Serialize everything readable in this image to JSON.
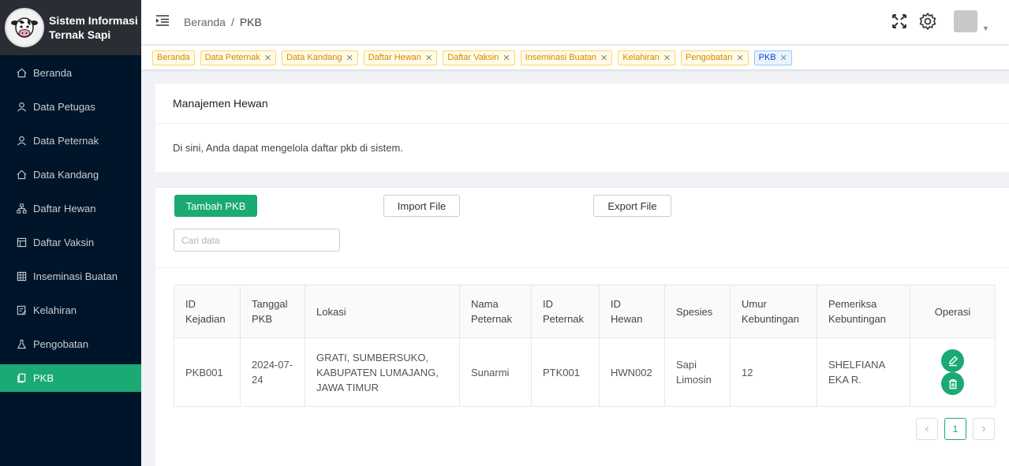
{
  "app": {
    "title_line1": "Sistem Informasi",
    "title_line2": "Ternak Sapi"
  },
  "sidebar": {
    "items": [
      {
        "label": "Beranda",
        "icon": "home-icon"
      },
      {
        "label": "Data Petugas",
        "icon": "user-icon"
      },
      {
        "label": "Data Peternak",
        "icon": "user-icon"
      },
      {
        "label": "Data Kandang",
        "icon": "home-icon"
      },
      {
        "label": "Daftar Hewan",
        "icon": "cluster-icon"
      },
      {
        "label": "Daftar Vaksin",
        "icon": "calendar-icon"
      },
      {
        "label": "Inseminasi Buatan",
        "icon": "table-icon"
      },
      {
        "label": "Kelahiran",
        "icon": "form-icon"
      },
      {
        "label": "Pengobatan",
        "icon": "experiment-icon"
      },
      {
        "label": "PKB",
        "icon": "copy-icon"
      }
    ],
    "active_index": 9
  },
  "header": {
    "breadcrumb_home": "Beranda",
    "breadcrumb_sep": "/",
    "breadcrumb_current": "PKB"
  },
  "tags": [
    {
      "label": "Beranda",
      "closable": false
    },
    {
      "label": "Data Peternak",
      "closable": true
    },
    {
      "label": "Data Kandang",
      "closable": true
    },
    {
      "label": "Daftar Hewan",
      "closable": true
    },
    {
      "label": "Daftar Vaksin",
      "closable": true
    },
    {
      "label": "Inseminasi Buatan",
      "closable": true
    },
    {
      "label": "Kelahiran",
      "closable": true
    },
    {
      "label": "Pengobatan",
      "closable": true
    },
    {
      "label": "PKB",
      "closable": true,
      "active": true
    }
  ],
  "intro": {
    "title": "Manajemen Hewan",
    "description": "Di sini, Anda dapat mengelola daftar pkb di sistem."
  },
  "toolbar": {
    "add_label": "Tambah PKB",
    "import_label": "Import File",
    "export_label": "Export File",
    "search_placeholder": "Cari data"
  },
  "table": {
    "headers": [
      "ID Kejadian",
      "Tanggal PKB",
      "Lokasi",
      "Nama Peternak",
      "ID Peternak",
      "ID Hewan",
      "Spesies",
      "Umur Kebuntingan",
      "Pemeriksa Kebuntingan",
      "Operasi"
    ],
    "rows": [
      {
        "id_kejadian": "PKB001",
        "tanggal": "2024-07-24",
        "lokasi": "GRATI, SUMBERSUKO, KABUPATEN LUMAJANG, JAWA TIMUR",
        "nama_peternak": "Sunarmi",
        "id_peternak": "PTK001",
        "id_hewan": "HWN002",
        "spesies": "Sapi Limosin",
        "umur": "12",
        "pemeriksa": "SHELFIANA EKA R."
      }
    ]
  },
  "pagination": {
    "current_page": "1"
  },
  "colors": {
    "primary": "#1aaa73",
    "sidebar_bg": "#001529",
    "tag_bg": "#fffbe6"
  }
}
